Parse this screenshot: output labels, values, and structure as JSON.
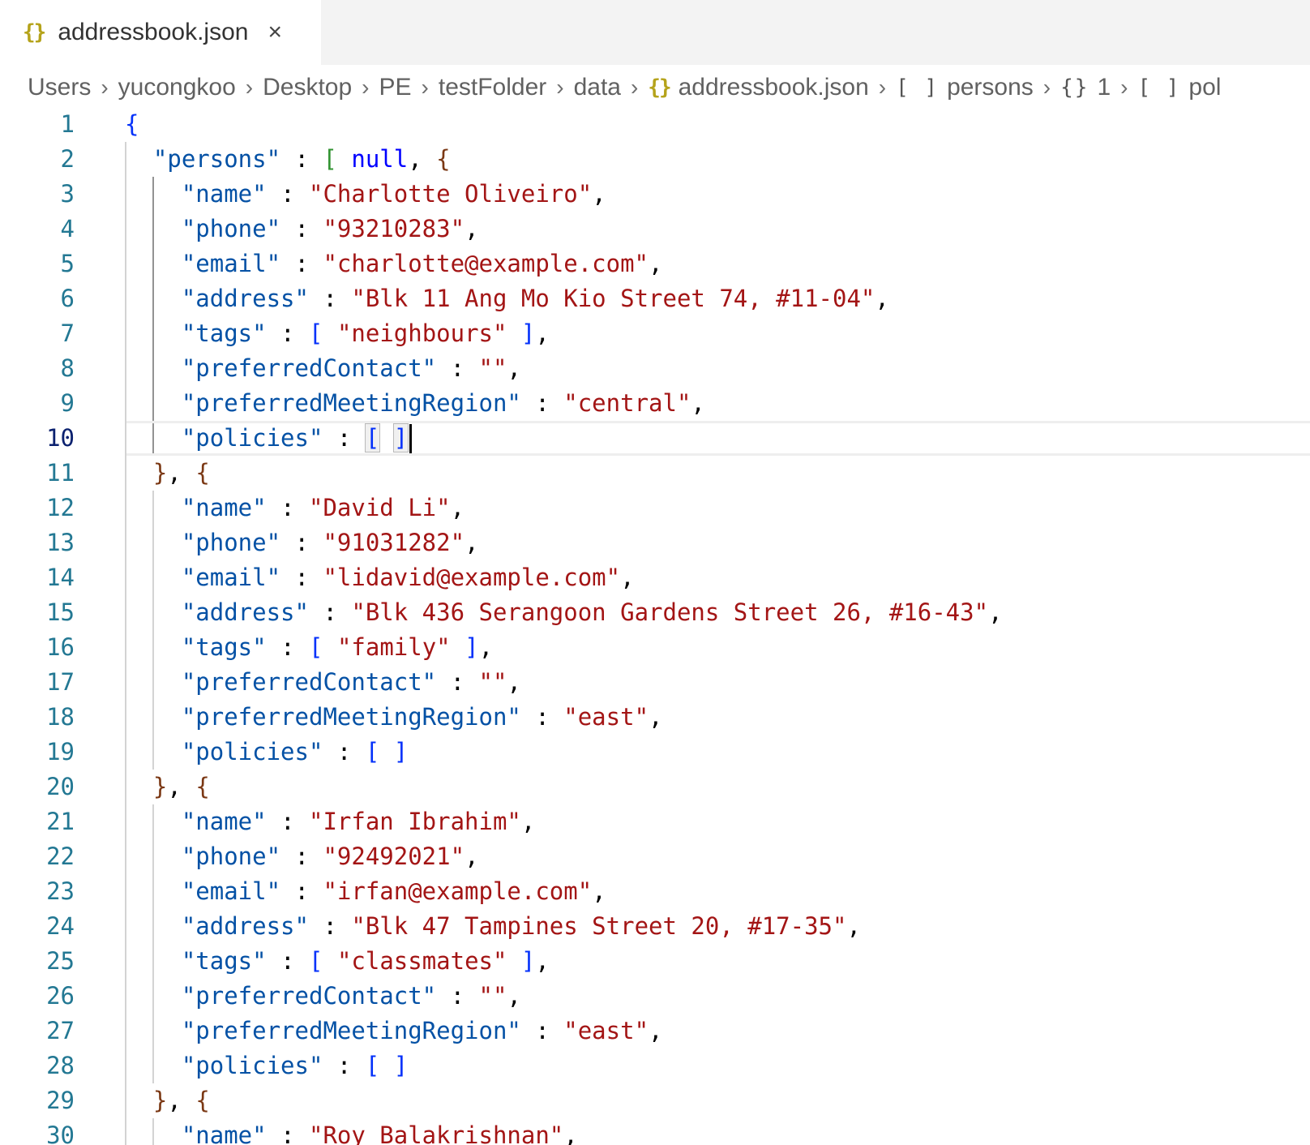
{
  "tab": {
    "icon": "{}",
    "label": "addressbook.json",
    "close": "×"
  },
  "breadcrumb": [
    {
      "label": "Users"
    },
    {
      "label": "yucongkoo"
    },
    {
      "label": "Desktop"
    },
    {
      "label": "PE"
    },
    {
      "label": "testFolder"
    },
    {
      "label": "data"
    },
    {
      "label": "addressbook.json",
      "icon": "{}",
      "icon_name": "json-file-icon"
    },
    {
      "label": "persons",
      "icon": "[ ]",
      "icon_name": "array-icon"
    },
    {
      "label": "1",
      "icon": "{}",
      "icon_name": "object-icon"
    },
    {
      "label": "pol",
      "icon": "[ ]",
      "icon_name": "array-icon"
    }
  ],
  "current_line": 10,
  "lines": [
    {
      "n": "1",
      "guides": [],
      "parts": [
        [
          "b1",
          "{"
        ]
      ]
    },
    {
      "n": "2",
      "guides": [
        0
      ],
      "parts": [
        [
          "p",
          "  "
        ],
        [
          "k",
          "\"persons\""
        ],
        [
          "p",
          " : "
        ],
        [
          "b2",
          "["
        ],
        [
          "p",
          " "
        ],
        [
          "nul",
          "null"
        ],
        [
          "p",
          ", "
        ],
        [
          "b3",
          "{"
        ]
      ]
    },
    {
      "n": "3",
      "guides": [
        0,
        1
      ],
      "parts": [
        [
          "p",
          "    "
        ],
        [
          "k",
          "\"name\""
        ],
        [
          "p",
          " : "
        ],
        [
          "s",
          "\"Charlotte Oliveiro\""
        ],
        [
          "p",
          ","
        ]
      ]
    },
    {
      "n": "4",
      "guides": [
        0,
        1
      ],
      "parts": [
        [
          "p",
          "    "
        ],
        [
          "k",
          "\"phone\""
        ],
        [
          "p",
          " : "
        ],
        [
          "s",
          "\"93210283\""
        ],
        [
          "p",
          ","
        ]
      ]
    },
    {
      "n": "5",
      "guides": [
        0,
        1
      ],
      "parts": [
        [
          "p",
          "    "
        ],
        [
          "k",
          "\"email\""
        ],
        [
          "p",
          " : "
        ],
        [
          "s",
          "\"charlotte@example.com\""
        ],
        [
          "p",
          ","
        ]
      ]
    },
    {
      "n": "6",
      "guides": [
        0,
        1
      ],
      "parts": [
        [
          "p",
          "    "
        ],
        [
          "k",
          "\"address\""
        ],
        [
          "p",
          " : "
        ],
        [
          "s",
          "\"Blk 11 Ang Mo Kio Street 74, #11-04\""
        ],
        [
          "p",
          ","
        ]
      ]
    },
    {
      "n": "7",
      "guides": [
        0,
        1
      ],
      "parts": [
        [
          "p",
          "    "
        ],
        [
          "k",
          "\"tags\""
        ],
        [
          "p",
          " : "
        ],
        [
          "b1",
          "["
        ],
        [
          "p",
          " "
        ],
        [
          "s",
          "\"neighbours\""
        ],
        [
          "p",
          " "
        ],
        [
          "b1",
          "]"
        ],
        [
          "p",
          ","
        ]
      ]
    },
    {
      "n": "8",
      "guides": [
        0,
        1
      ],
      "parts": [
        [
          "p",
          "    "
        ],
        [
          "k",
          "\"preferredContact\""
        ],
        [
          "p",
          " : "
        ],
        [
          "s",
          "\"\""
        ],
        [
          "p",
          ","
        ]
      ]
    },
    {
      "n": "9",
      "guides": [
        0,
        1
      ],
      "parts": [
        [
          "p",
          "    "
        ],
        [
          "k",
          "\"preferredMeetingRegion\""
        ],
        [
          "p",
          " : "
        ],
        [
          "s",
          "\"central\""
        ],
        [
          "p",
          ","
        ]
      ]
    },
    {
      "n": "10",
      "guides": [
        0,
        1
      ],
      "parts": [
        [
          "p",
          "    "
        ],
        [
          "k",
          "\"policies\""
        ],
        [
          "p",
          " : "
        ],
        [
          "b1 hl",
          "["
        ],
        [
          "p",
          " "
        ],
        [
          "b1 hl",
          "]"
        ],
        [
          "cursor",
          ""
        ]
      ]
    },
    {
      "n": "11",
      "guides": [
        0
      ],
      "parts": [
        [
          "p",
          "  "
        ],
        [
          "b3",
          "}"
        ],
        [
          "p",
          ", "
        ],
        [
          "b3",
          "{"
        ]
      ]
    },
    {
      "n": "12",
      "guides": [
        0,
        1
      ],
      "parts": [
        [
          "p",
          "    "
        ],
        [
          "k",
          "\"name\""
        ],
        [
          "p",
          " : "
        ],
        [
          "s",
          "\"David Li\""
        ],
        [
          "p",
          ","
        ]
      ]
    },
    {
      "n": "13",
      "guides": [
        0,
        1
      ],
      "parts": [
        [
          "p",
          "    "
        ],
        [
          "k",
          "\"phone\""
        ],
        [
          "p",
          " : "
        ],
        [
          "s",
          "\"91031282\""
        ],
        [
          "p",
          ","
        ]
      ]
    },
    {
      "n": "14",
      "guides": [
        0,
        1
      ],
      "parts": [
        [
          "p",
          "    "
        ],
        [
          "k",
          "\"email\""
        ],
        [
          "p",
          " : "
        ],
        [
          "s",
          "\"lidavid@example.com\""
        ],
        [
          "p",
          ","
        ]
      ]
    },
    {
      "n": "15",
      "guides": [
        0,
        1
      ],
      "parts": [
        [
          "p",
          "    "
        ],
        [
          "k",
          "\"address\""
        ],
        [
          "p",
          " : "
        ],
        [
          "s",
          "\"Blk 436 Serangoon Gardens Street 26, #16-43\""
        ],
        [
          "p",
          ","
        ]
      ]
    },
    {
      "n": "16",
      "guides": [
        0,
        1
      ],
      "parts": [
        [
          "p",
          "    "
        ],
        [
          "k",
          "\"tags\""
        ],
        [
          "p",
          " : "
        ],
        [
          "b1",
          "["
        ],
        [
          "p",
          " "
        ],
        [
          "s",
          "\"family\""
        ],
        [
          "p",
          " "
        ],
        [
          "b1",
          "]"
        ],
        [
          "p",
          ","
        ]
      ]
    },
    {
      "n": "17",
      "guides": [
        0,
        1
      ],
      "parts": [
        [
          "p",
          "    "
        ],
        [
          "k",
          "\"preferredContact\""
        ],
        [
          "p",
          " : "
        ],
        [
          "s",
          "\"\""
        ],
        [
          "p",
          ","
        ]
      ]
    },
    {
      "n": "18",
      "guides": [
        0,
        1
      ],
      "parts": [
        [
          "p",
          "    "
        ],
        [
          "k",
          "\"preferredMeetingRegion\""
        ],
        [
          "p",
          " : "
        ],
        [
          "s",
          "\"east\""
        ],
        [
          "p",
          ","
        ]
      ]
    },
    {
      "n": "19",
      "guides": [
        0,
        1
      ],
      "parts": [
        [
          "p",
          "    "
        ],
        [
          "k",
          "\"policies\""
        ],
        [
          "p",
          " : "
        ],
        [
          "b1",
          "["
        ],
        [
          "p",
          " "
        ],
        [
          "b1",
          "]"
        ]
      ]
    },
    {
      "n": "20",
      "guides": [
        0
      ],
      "parts": [
        [
          "p",
          "  "
        ],
        [
          "b3",
          "}"
        ],
        [
          "p",
          ", "
        ],
        [
          "b3",
          "{"
        ]
      ]
    },
    {
      "n": "21",
      "guides": [
        0,
        1
      ],
      "parts": [
        [
          "p",
          "    "
        ],
        [
          "k",
          "\"name\""
        ],
        [
          "p",
          " : "
        ],
        [
          "s",
          "\"Irfan Ibrahim\""
        ],
        [
          "p",
          ","
        ]
      ]
    },
    {
      "n": "22",
      "guides": [
        0,
        1
      ],
      "parts": [
        [
          "p",
          "    "
        ],
        [
          "k",
          "\"phone\""
        ],
        [
          "p",
          " : "
        ],
        [
          "s",
          "\"92492021\""
        ],
        [
          "p",
          ","
        ]
      ]
    },
    {
      "n": "23",
      "guides": [
        0,
        1
      ],
      "parts": [
        [
          "p",
          "    "
        ],
        [
          "k",
          "\"email\""
        ],
        [
          "p",
          " : "
        ],
        [
          "s",
          "\"irfan@example.com\""
        ],
        [
          "p",
          ","
        ]
      ]
    },
    {
      "n": "24",
      "guides": [
        0,
        1
      ],
      "parts": [
        [
          "p",
          "    "
        ],
        [
          "k",
          "\"address\""
        ],
        [
          "p",
          " : "
        ],
        [
          "s",
          "\"Blk 47 Tampines Street 20, #17-35\""
        ],
        [
          "p",
          ","
        ]
      ]
    },
    {
      "n": "25",
      "guides": [
        0,
        1
      ],
      "parts": [
        [
          "p",
          "    "
        ],
        [
          "k",
          "\"tags\""
        ],
        [
          "p",
          " : "
        ],
        [
          "b1",
          "["
        ],
        [
          "p",
          " "
        ],
        [
          "s",
          "\"classmates\""
        ],
        [
          "p",
          " "
        ],
        [
          "b1",
          "]"
        ],
        [
          "p",
          ","
        ]
      ]
    },
    {
      "n": "26",
      "guides": [
        0,
        1
      ],
      "parts": [
        [
          "p",
          "    "
        ],
        [
          "k",
          "\"preferredContact\""
        ],
        [
          "p",
          " : "
        ],
        [
          "s",
          "\"\""
        ],
        [
          "p",
          ","
        ]
      ]
    },
    {
      "n": "27",
      "guides": [
        0,
        1
      ],
      "parts": [
        [
          "p",
          "    "
        ],
        [
          "k",
          "\"preferredMeetingRegion\""
        ],
        [
          "p",
          " : "
        ],
        [
          "s",
          "\"east\""
        ],
        [
          "p",
          ","
        ]
      ]
    },
    {
      "n": "28",
      "guides": [
        0,
        1
      ],
      "parts": [
        [
          "p",
          "    "
        ],
        [
          "k",
          "\"policies\""
        ],
        [
          "p",
          " : "
        ],
        [
          "b1",
          "["
        ],
        [
          "p",
          " "
        ],
        [
          "b1",
          "]"
        ]
      ]
    },
    {
      "n": "29",
      "guides": [
        0
      ],
      "parts": [
        [
          "p",
          "  "
        ],
        [
          "b3",
          "}"
        ],
        [
          "p",
          ", "
        ],
        [
          "b3",
          "{"
        ]
      ]
    },
    {
      "n": "30",
      "guides": [
        0,
        1
      ],
      "parts": [
        [
          "p",
          "    "
        ],
        [
          "k",
          "\"name\""
        ],
        [
          "p",
          " : "
        ],
        [
          "s",
          "\"Roy Balakrishnan\""
        ],
        [
          "p",
          ","
        ]
      ]
    }
  ],
  "colors": {
    "key": "#0451a5",
    "string": "#a31515",
    "bracket_level1": "#0431fa",
    "bracket_level2": "#319331",
    "bracket_level3": "#7b3814",
    "line_number": "#237893",
    "json_icon": "#b5a31b"
  }
}
